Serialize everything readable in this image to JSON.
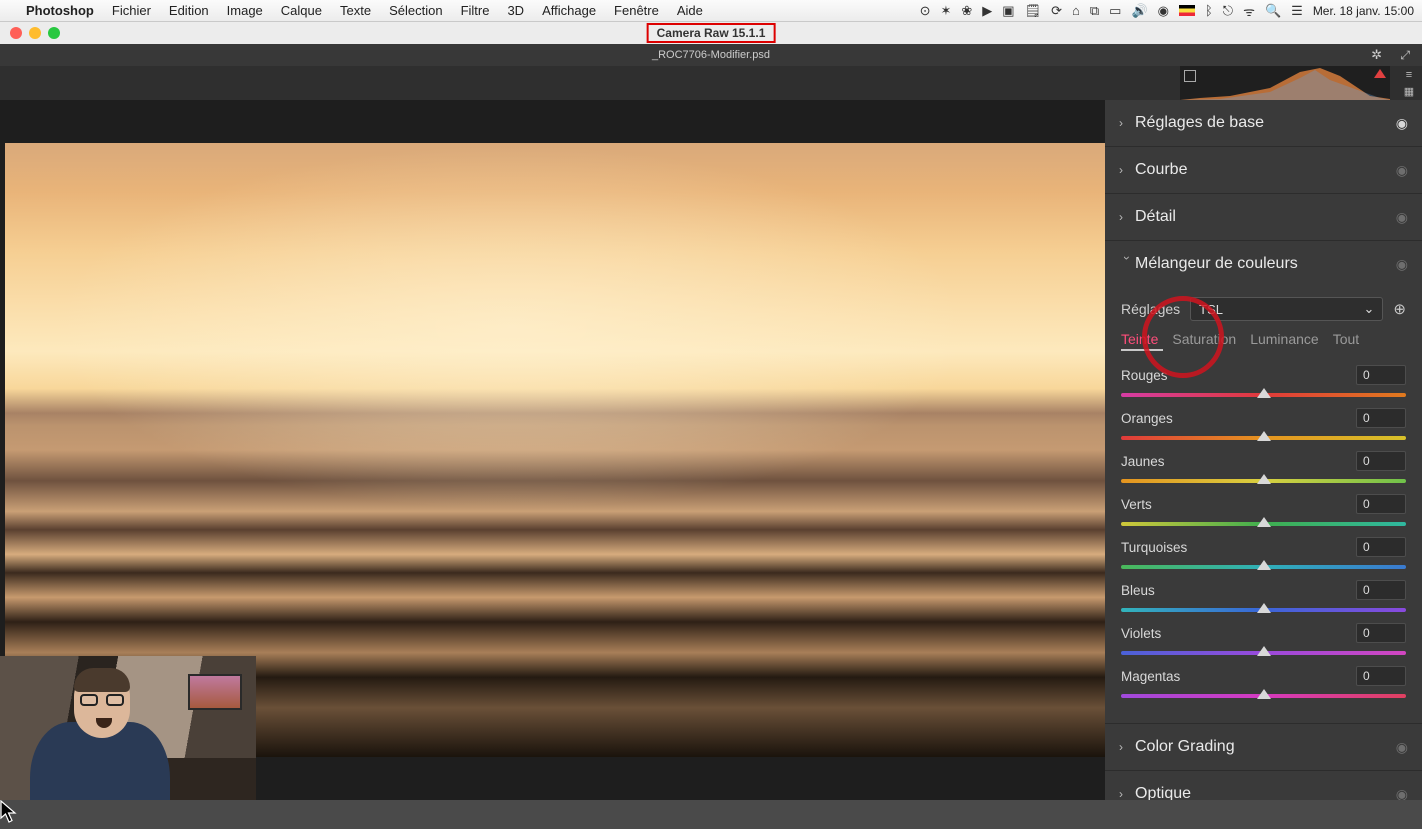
{
  "menubar": {
    "apple": "",
    "app": "Photoshop",
    "items": [
      "Fichier",
      "Edition",
      "Image",
      "Calque",
      "Texte",
      "Sélection",
      "Filtre",
      "3D",
      "Affichage",
      "Fenêtre",
      "Aide"
    ],
    "clock": "Mer. 18 janv.  15:00"
  },
  "titlebar": {
    "camera_raw": "Camera Raw 15.1.1"
  },
  "tabbar": {
    "filename": "_ROC7706-Modifier.psd"
  },
  "panel": {
    "sections": {
      "basic": "Réglages de base",
      "curve": "Courbe",
      "detail": "Détail",
      "mixer": "Mélangeur de couleurs",
      "grading": "Color Grading",
      "optique": "Optique"
    },
    "mixer": {
      "reglages_lbl": "Réglages",
      "mode": "TSL",
      "tabs": {
        "teinte": "Teinte",
        "saturation": "Saturation",
        "luminance": "Luminance",
        "tout": "Tout"
      },
      "sliders": [
        {
          "key": "rouges",
          "label": "Rouges",
          "value": "0",
          "grad": "g-rouges"
        },
        {
          "key": "oranges",
          "label": "Oranges",
          "value": "0",
          "grad": "g-oranges"
        },
        {
          "key": "jaunes",
          "label": "Jaunes",
          "value": "0",
          "grad": "g-jaunes"
        },
        {
          "key": "verts",
          "label": "Verts",
          "value": "0",
          "grad": "g-verts"
        },
        {
          "key": "turquoises",
          "label": "Turquoises",
          "value": "0",
          "grad": "g-turq"
        },
        {
          "key": "bleus",
          "label": "Bleus",
          "value": "0",
          "grad": "g-bleus"
        },
        {
          "key": "violets",
          "label": "Violets",
          "value": "0",
          "grad": "g-violets"
        },
        {
          "key": "magentas",
          "label": "Magentas",
          "value": "0",
          "grad": "g-magentas"
        }
      ]
    }
  }
}
